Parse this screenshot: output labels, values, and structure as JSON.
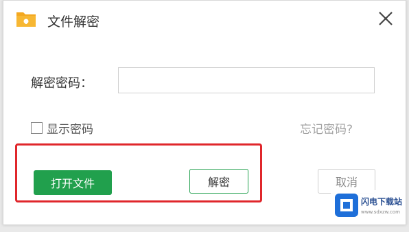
{
  "window": {
    "title": "文件解密",
    "icon": "folder-lock-icon"
  },
  "form": {
    "password_label": "解密密码：",
    "password_value": "",
    "show_password_label": "显示密码",
    "show_password_checked": false,
    "forgot_password_link": "忘记密码?"
  },
  "buttons": {
    "open_file": "打开文件",
    "decrypt": "解密",
    "cancel": "取消"
  },
  "watermark": {
    "logo_text": "闪电下载站",
    "url": "www.sdxzw.com"
  },
  "colors": {
    "accent_green": "#21a04d",
    "highlight_red": "#e0262b",
    "folder_orange": "#f4a81f"
  }
}
